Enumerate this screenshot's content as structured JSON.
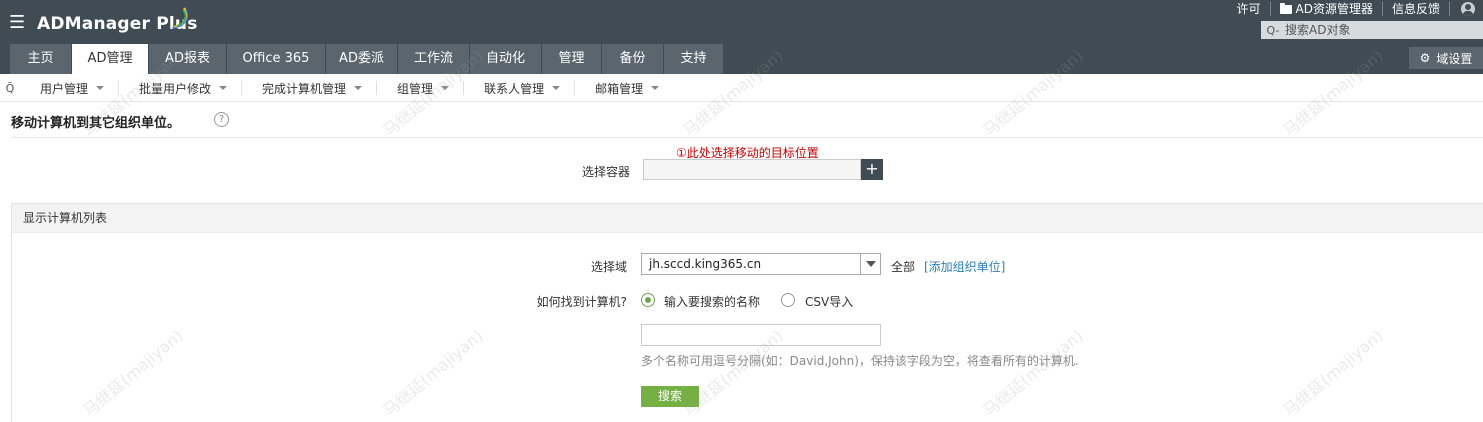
{
  "header": {
    "menu_icon": "hamburger-icon",
    "logo_text": "ADManager Plus",
    "top_links": [
      {
        "label": "许可"
      },
      {
        "label": "AD资源管理器",
        "icon": "folder-icon"
      },
      {
        "label": "信息反馈"
      }
    ],
    "user_icon": "user-icon",
    "search_placeholder": "搜索AD对象",
    "domain_settings_label": "域设置",
    "tabs": [
      "主页",
      "AD管理",
      "AD报表",
      "Office 365",
      "AD委派",
      "工作流",
      "自动化",
      "管理",
      "备份",
      "支持"
    ],
    "active_tab": "AD管理"
  },
  "subnav": {
    "items": [
      "用户管理",
      "批量用户修改",
      "完成计算机管理",
      "组管理",
      "联系人管理",
      "邮箱管理"
    ]
  },
  "page": {
    "title": "移动计算机到其它组织单位。",
    "hint": "①此处选择移动的目标位置",
    "container_label": "选择容器",
    "container_value": "",
    "section_title": "显示计算机列表",
    "domain_label": "选择域",
    "domain_value": "jh.sccd.king365.cn",
    "all_label": "全部",
    "add_ou_link": "[添加组织单位]",
    "find_label": "如何找到计算机?",
    "option_search_name": "输入要搜索的名称",
    "option_csv": "CSV导入",
    "selected_option": "输入要搜索的名称",
    "name_input_value": "",
    "help_text": "多个名称可用逗号分隔(如：David,John)，保持该字段为空，将查看所有的计算机.",
    "search_button": "搜索"
  },
  "watermark_text": "马继延(majiyan)",
  "colors": {
    "topbar": "#404b53",
    "tab_bg": "#5a656d",
    "hint": "#cc0000",
    "link": "#2a7fb8",
    "search_button": "#75b043",
    "radio_checked": "#6aa84f"
  }
}
